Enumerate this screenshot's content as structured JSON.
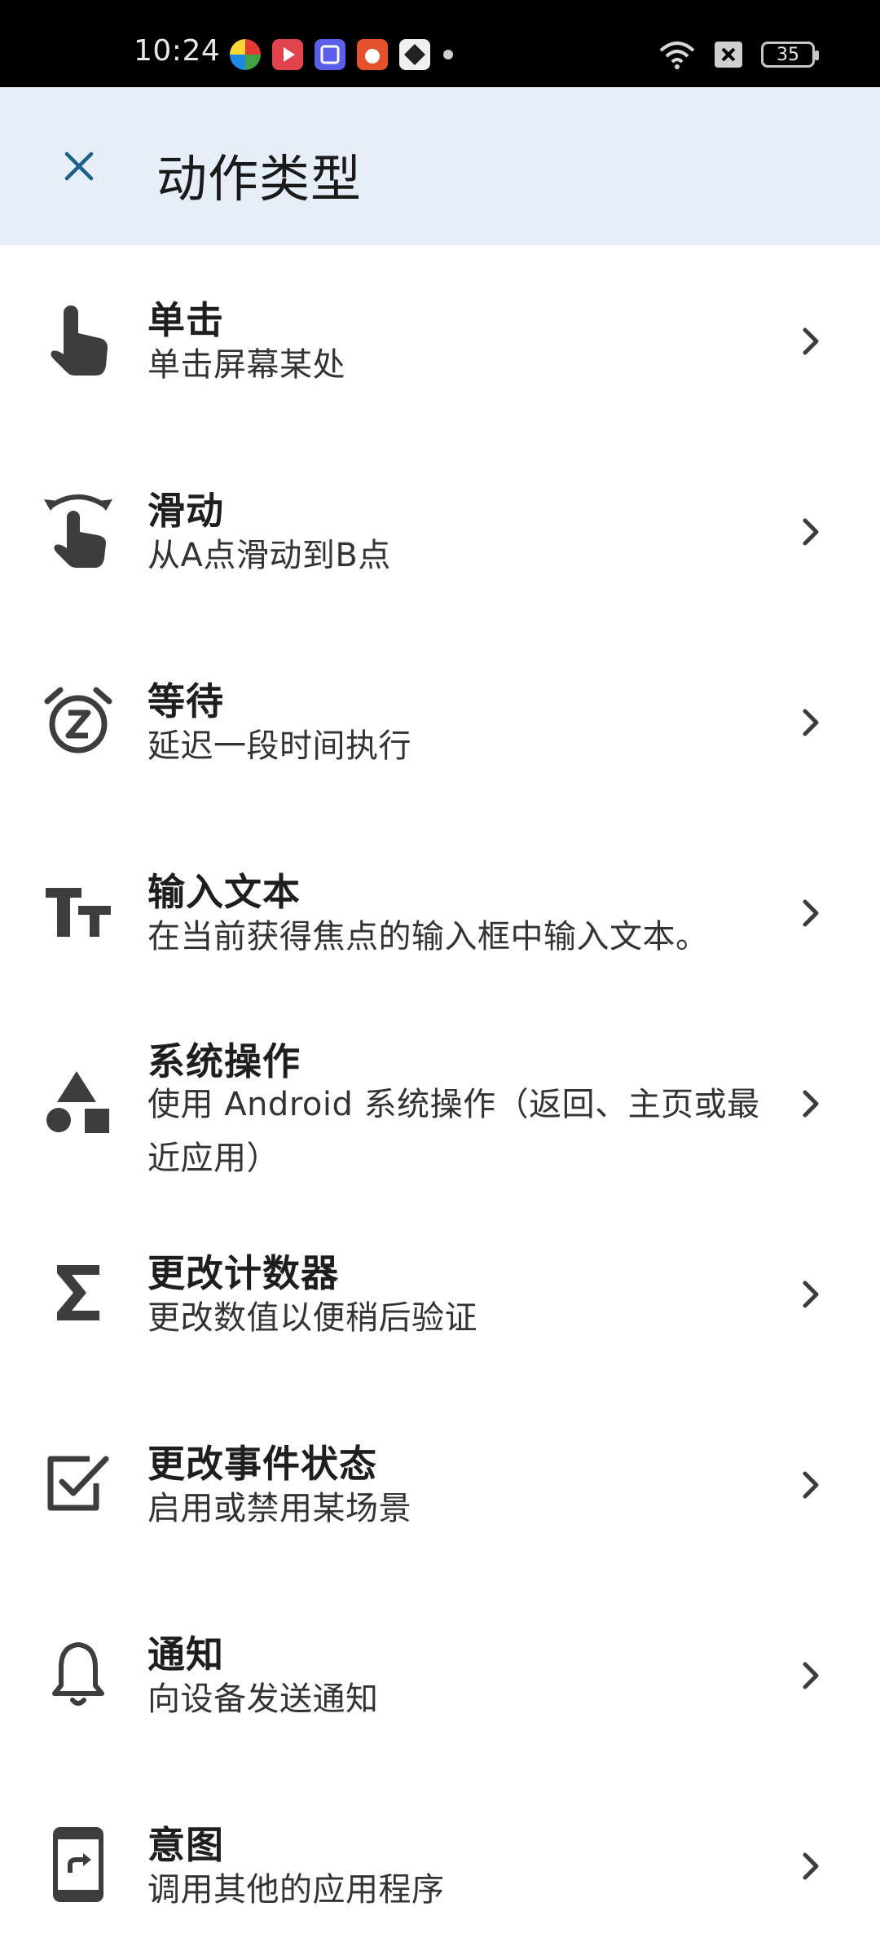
{
  "status_bar": {
    "time": "10:24",
    "battery": "35"
  },
  "header": {
    "title": "动作类型",
    "close_icon": "close-icon"
  },
  "items": [
    {
      "title": "单击",
      "desc": "单击屏幕某处",
      "icon": "touch-icon"
    },
    {
      "title": "滑动",
      "desc": "从A点滑动到B点",
      "icon": "swipe-icon"
    },
    {
      "title": "等待",
      "desc": "延迟一段时间执行",
      "icon": "snooze-alarm-icon"
    },
    {
      "title": "输入文本",
      "desc": "在当前获得焦点的输入框中输入文本。",
      "icon": "text-fields-icon"
    },
    {
      "title": "系统操作",
      "desc": "使用 Android 系统操作（返回、主页或最近应用）",
      "icon": "shapes-icon"
    },
    {
      "title": "更改计数器",
      "desc": "更改数值以便稍后验证",
      "icon": "sigma-icon"
    },
    {
      "title": "更改事件状态",
      "desc": "启用或禁用某场景",
      "icon": "checkbox-icon"
    },
    {
      "title": "通知",
      "desc": "向设备发送通知",
      "icon": "bell-icon"
    },
    {
      "title": "意图",
      "desc": "调用其他的应用程序",
      "icon": "phone-forward-icon"
    }
  ],
  "colors": {
    "app_bar_bg": "#e6eef8",
    "accent": "#1d5f8a",
    "icon": "#3d3d3d"
  }
}
